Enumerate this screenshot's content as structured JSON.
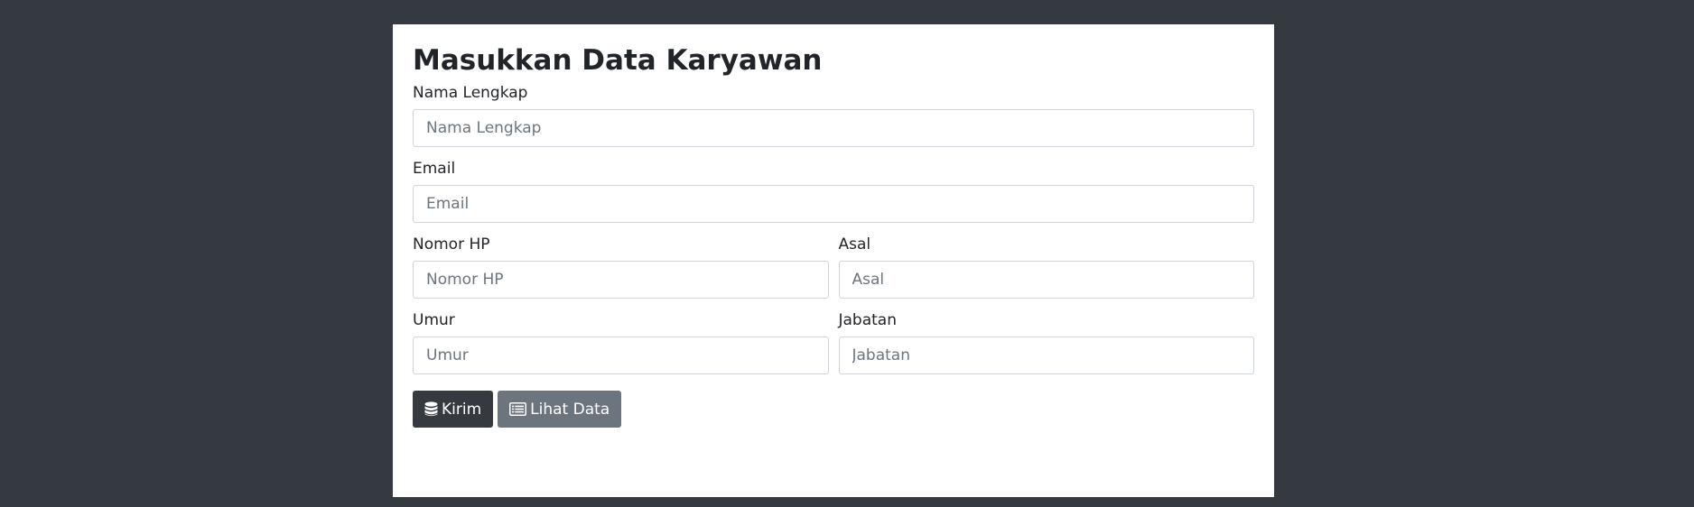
{
  "form": {
    "title": "Masukkan Data Karyawan",
    "fields": {
      "nama": {
        "label": "Nama Lengkap",
        "placeholder": "Nama Lengkap",
        "value": ""
      },
      "email": {
        "label": "Email",
        "placeholder": "Email",
        "value": ""
      },
      "nomor_hp": {
        "label": "Nomor HP",
        "placeholder": "Nomor HP",
        "value": ""
      },
      "asal": {
        "label": "Asal",
        "placeholder": "Asal",
        "value": ""
      },
      "umur": {
        "label": "Umur",
        "placeholder": "Umur",
        "value": ""
      },
      "jabatan": {
        "label": "Jabatan",
        "placeholder": "Jabatan",
        "value": ""
      }
    },
    "buttons": {
      "submit": {
        "label": "Kirim",
        "icon": "database-icon"
      },
      "view": {
        "label": "Lihat Data",
        "icon": "list-alt-icon"
      }
    }
  },
  "colors": {
    "background": "#343a40",
    "card": "#ffffff",
    "button_dark": "#343a40",
    "button_secondary": "#6c757d",
    "input_border": "#ced4da",
    "placeholder": "#6c757d"
  }
}
